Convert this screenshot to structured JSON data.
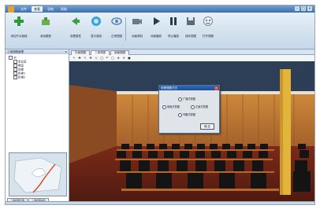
{
  "menubar": {
    "items": [
      {
        "label": "文件"
      },
      {
        "label": "查看"
      },
      {
        "label": "导航"
      },
      {
        "label": "帮助"
      }
    ],
    "active_index": 1
  },
  "toolbar": {
    "buttons": [
      {
        "label": "添加节点链接",
        "icon": "add-icon",
        "color": "#2f9a3a"
      },
      {
        "label": "添加模型",
        "icon": "model-icon",
        "color": "#6bb04a"
      },
      {
        "label": "查看属性",
        "icon": "arrow-icon",
        "color": "#3d9c4a"
      },
      {
        "label": "显示漫游",
        "icon": "globe-icon",
        "color": "#3aa0d8"
      },
      {
        "label": "正常视图",
        "icon": "eye-icon",
        "color": "#5a7fc0"
      },
      {
        "label": "动画录制",
        "icon": "camera-icon",
        "color": "#6a7a8a"
      },
      {
        "label": "动画播放",
        "icon": "play-icon",
        "color": "#2c3a4c"
      },
      {
        "label": "停止播放",
        "icon": "pause-icon",
        "color": "#2c3a4c"
      },
      {
        "label": "保存视图",
        "icon": "save-icon",
        "color": "#5a6a7a"
      },
      {
        "label": "打开视图",
        "icon": "open-icon",
        "color": "#7a8a9a"
      }
    ]
  },
  "left_panel": {
    "title": "三维视图管理",
    "tree": [
      "3F",
      "会议室",
      "教室",
      "走廊",
      "阶梯1",
      "阶梯2"
    ],
    "bottom_tabs": [
      "三维视图管理",
      "三维视图操作"
    ]
  },
  "view_tabs": [
    "平面视图",
    "三维视图",
    "剖面视图"
  ],
  "view_tools": [
    "↖",
    "✚",
    "↖",
    "✥",
    "◇",
    "◯",
    "↶",
    "▢",
    "⊕",
    "⊖",
    "●"
  ],
  "dialog": {
    "title": "查看视图方式",
    "options": [
      "广播式视图",
      "侧面式视图",
      "正面式视图",
      "鸟瞰式视图"
    ],
    "ok_label": "确 定",
    "close_label": "×"
  },
  "window_controls": [
    "–",
    "▢",
    "×"
  ],
  "colors": {
    "title_bar": "#3f6fa8",
    "ribbon": "#d4e2ef",
    "wall": "#c07a33",
    "chair": "#141414",
    "floor": "#6a2416",
    "column": "#e2b43a"
  }
}
